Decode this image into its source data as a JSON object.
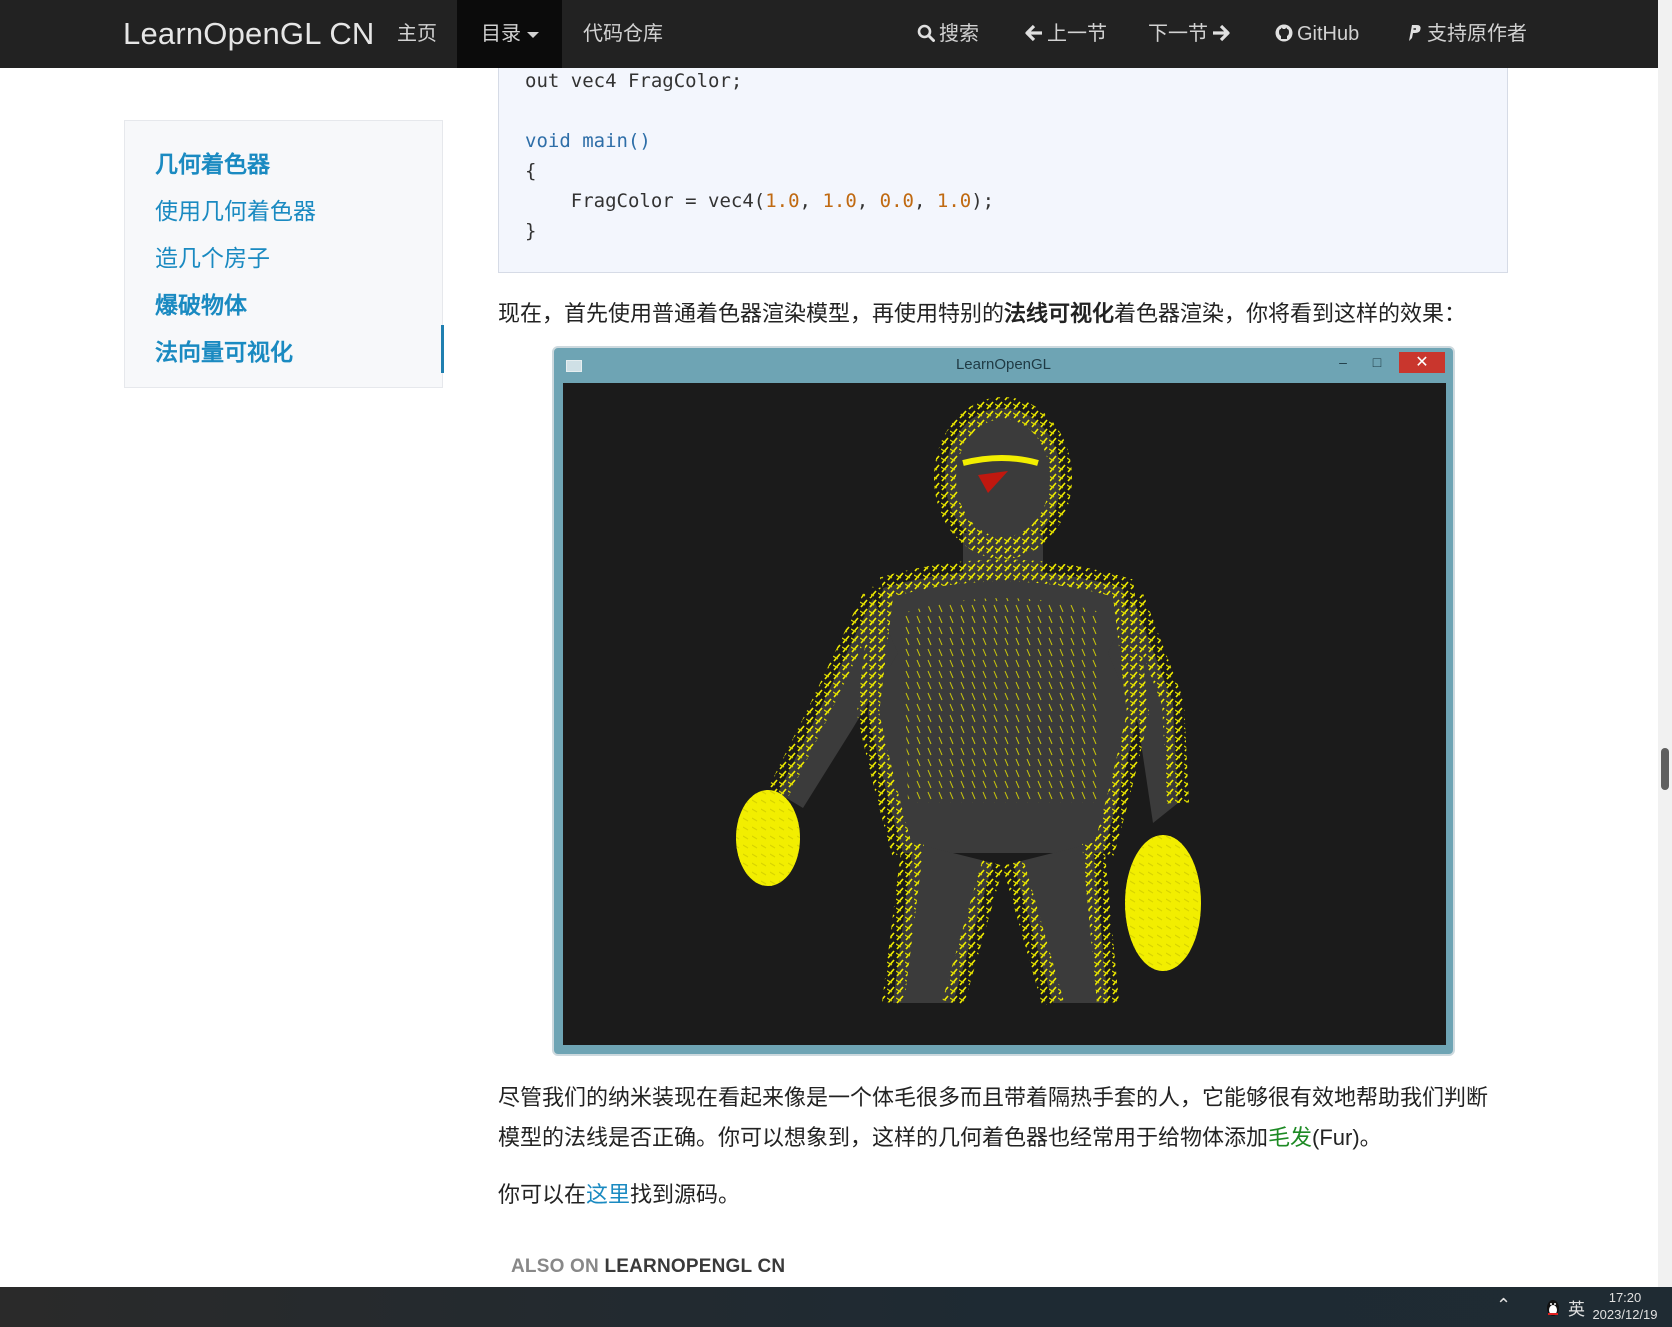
{
  "navbar": {
    "brand": "LearnOpenGL CN",
    "home": "主页",
    "toc": "目录",
    "repo": "代码仓库",
    "search": "搜索",
    "prev": "上一节",
    "next": "下一节",
    "github": "GitHub",
    "support": "支持原作者"
  },
  "sidebar": {
    "items": [
      {
        "label": "几何着色器",
        "bold": true
      },
      {
        "label": "使用几何着色器",
        "bold": false
      },
      {
        "label": "造几个房子",
        "bold": false
      },
      {
        "label": "爆破物体",
        "bold": true
      },
      {
        "label": "法向量可视化",
        "bold": true
      }
    ]
  },
  "code": {
    "line1": "out vec4 FragColor;",
    "line2_kw": "void",
    "line2_fn": " main()",
    "line3": "{",
    "line4_a": "    FragColor = vec4(",
    "v1": "1.0",
    "v2": "1.0",
    "v3": "0.0",
    "v4": "1.0",
    "sep": ", ",
    "line4_end": ");",
    "line5": "}"
  },
  "content": {
    "para1_a": "现在，首先使用普通着色器渲染模型，再使用特别的",
    "para1_bold": "法线可视化",
    "para1_b": "着色器渲染，你将看到这样的效果：",
    "window_title": "LearnOpenGL",
    "para2_line1": "尽管我们的纳米装现在看起来像是一个体毛很多而且带着隔热手套的人，它能够很有效地帮助我们判断",
    "para2_line2_a": "模型的法线是否正确。你可以想象到，这样的几何着色器也经常用于给物体添加",
    "para2_link": "毛发",
    "para2_line2_b": "(Fur)。",
    "para3_a": "你可以在",
    "para3_link": "这里",
    "para3_b": "找到源码。",
    "also_on_prefix": "ALSO ON ",
    "also_on_site": "LEARNOPENGL CN"
  },
  "taskbar": {
    "ime": "英",
    "time": "17:20",
    "date": "2023/12/19"
  },
  "colors": {
    "navbar_bg": "#222222",
    "link": "#1a8ac1",
    "fur": "#f2ee00",
    "code_bg": "#f3f6fd"
  }
}
